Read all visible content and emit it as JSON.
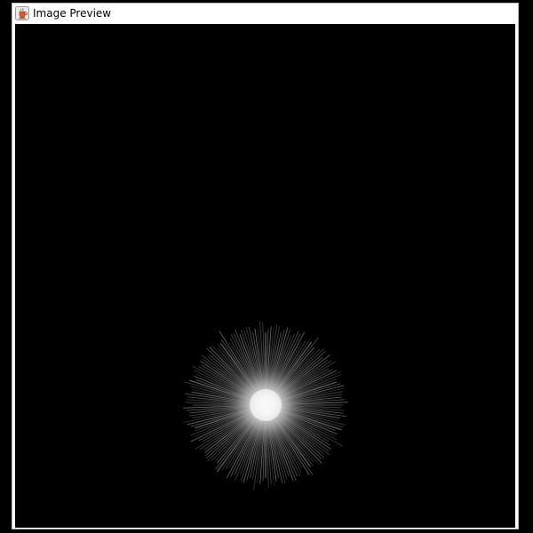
{
  "window": {
    "title": "Image Preview",
    "icon": "java-cup-icon"
  },
  "preview": {
    "background_color": "#000000",
    "image_description_colors": {
      "core": "#f2f2f2",
      "rays": "#d8d8d8"
    }
  }
}
